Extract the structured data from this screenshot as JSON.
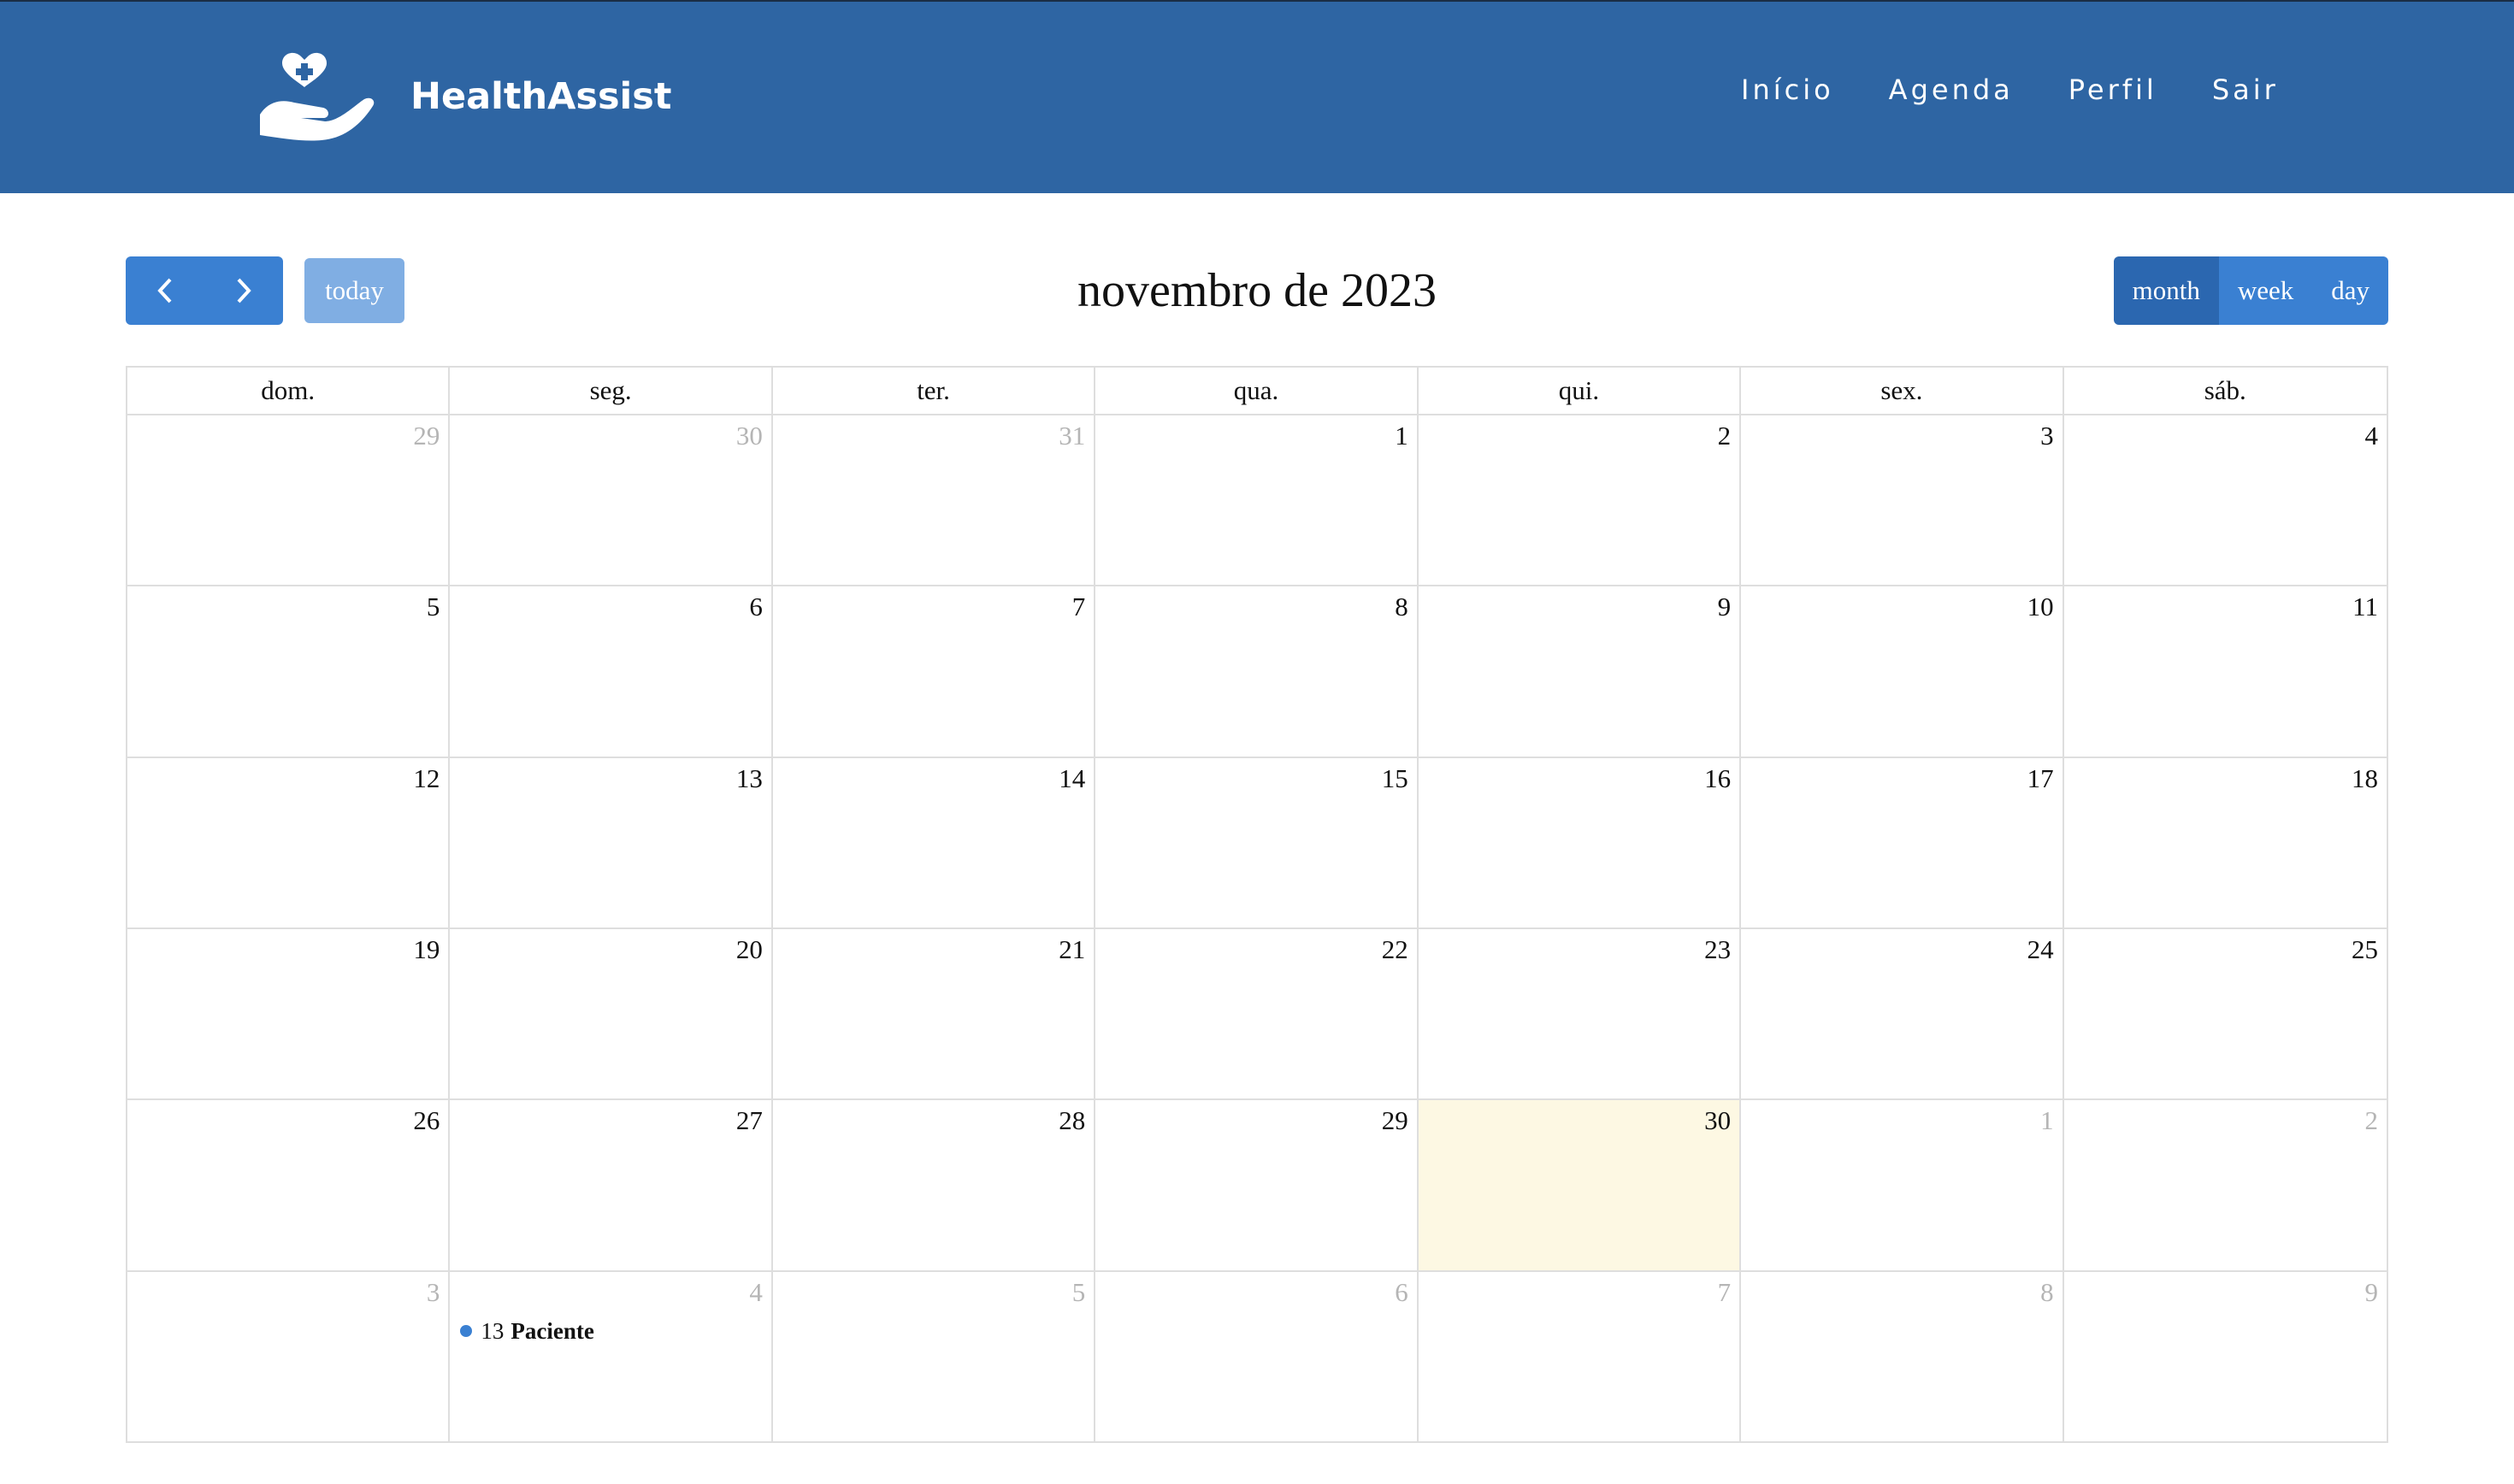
{
  "brand": {
    "name": "HealthAssist",
    "logo_icon": "heart-hand-icon"
  },
  "nav": {
    "items": [
      "Início",
      "Agenda",
      "Perfil",
      "Sair"
    ]
  },
  "toolbar": {
    "prev_icon": "chevron-left-icon",
    "next_icon": "chevron-right-icon",
    "today_label": "today",
    "title": "novembro de 2023",
    "views": [
      "month",
      "week",
      "day"
    ],
    "active_view": "month"
  },
  "calendar": {
    "weekdays": [
      "dom.",
      "seg.",
      "ter.",
      "qua.",
      "qui.",
      "sex.",
      "sáb."
    ],
    "weeks": [
      [
        {
          "d": "29",
          "o": true
        },
        {
          "d": "30",
          "o": true
        },
        {
          "d": "31",
          "o": true
        },
        {
          "d": "1"
        },
        {
          "d": "2"
        },
        {
          "d": "3"
        },
        {
          "d": "4"
        }
      ],
      [
        {
          "d": "5"
        },
        {
          "d": "6"
        },
        {
          "d": "7"
        },
        {
          "d": "8"
        },
        {
          "d": "9"
        },
        {
          "d": "10"
        },
        {
          "d": "11"
        }
      ],
      [
        {
          "d": "12"
        },
        {
          "d": "13"
        },
        {
          "d": "14"
        },
        {
          "d": "15"
        },
        {
          "d": "16"
        },
        {
          "d": "17"
        },
        {
          "d": "18"
        }
      ],
      [
        {
          "d": "19"
        },
        {
          "d": "20"
        },
        {
          "d": "21"
        },
        {
          "d": "22"
        },
        {
          "d": "23"
        },
        {
          "d": "24"
        },
        {
          "d": "25"
        }
      ],
      [
        {
          "d": "26"
        },
        {
          "d": "27"
        },
        {
          "d": "28"
        },
        {
          "d": "29"
        },
        {
          "d": "30",
          "today": true
        },
        {
          "d": "1",
          "o": true
        },
        {
          "d": "2",
          "o": true
        }
      ],
      [
        {
          "d": "3",
          "o": true
        },
        {
          "d": "4",
          "o": true,
          "event": {
            "time": "13",
            "title": "Paciente"
          }
        },
        {
          "d": "5",
          "o": true
        },
        {
          "d": "6",
          "o": true
        },
        {
          "d": "7",
          "o": true
        },
        {
          "d": "8",
          "o": true
        },
        {
          "d": "9",
          "o": true
        }
      ]
    ],
    "today_color": "#fdf8e3",
    "event_dot_color": "#3a80d2"
  },
  "colors": {
    "navbar": "#2e65a3",
    "button": "#3a80d2",
    "button_active": "#2b67b0",
    "today_button": "#80aee3"
  }
}
